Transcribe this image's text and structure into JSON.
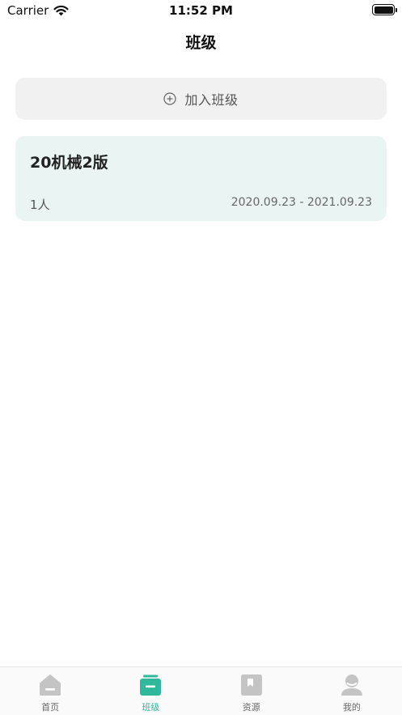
{
  "status_bar": {
    "carrier": "Carrier",
    "time": "11:52 PM"
  },
  "nav": {
    "title": "班级"
  },
  "join_button": {
    "label": "加入班级",
    "icon": "plus-circle-icon"
  },
  "classes": [
    {
      "name": "20机械2版",
      "members": "1人",
      "date_range": "2020.09.23 - 2021.09.23"
    }
  ],
  "tabs": [
    {
      "label": "首页",
      "icon": "home-icon",
      "active": false
    },
    {
      "label": "班级",
      "icon": "class-icon",
      "active": true
    },
    {
      "label": "资源",
      "icon": "book-icon",
      "active": false
    },
    {
      "label": "我的",
      "icon": "profile-icon",
      "active": false
    }
  ],
  "colors": {
    "accent": "#2fb89a",
    "inactive_icon": "#c4c4c4",
    "card_bg": "#eaf4f2",
    "button_bg": "#f1f1f1"
  }
}
